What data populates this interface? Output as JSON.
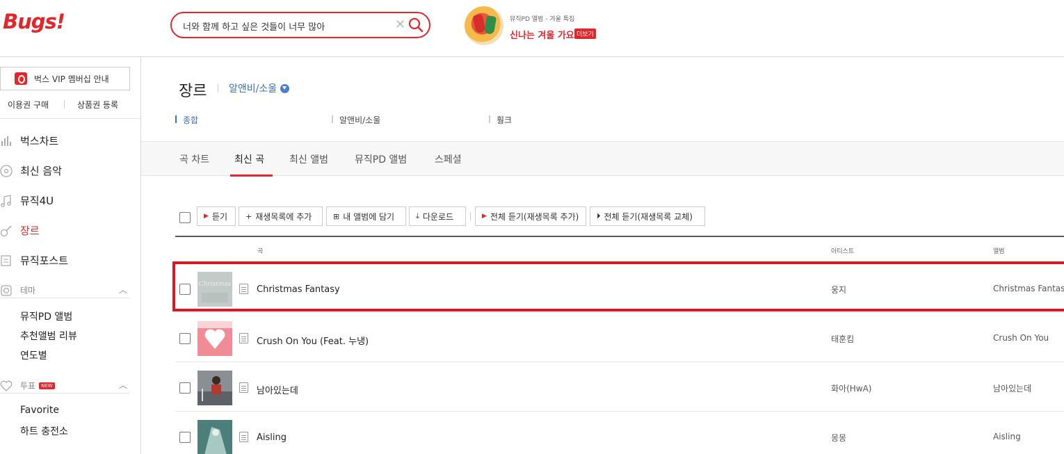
{
  "header": {
    "logo_text": "Bugs!",
    "search_value": "너와 함께 하고 싶은 것들이 너무 많아",
    "promo_subtitle": "뮤직PD 앨범 - 겨울 특집",
    "promo_title": "신나는 겨울 가요",
    "promo_more": "더보기"
  },
  "sidebar": {
    "vip_label": "벅스 VIP 멤버십 안내",
    "buy_pass": "이용권 구매",
    "register_coupon": "상품권 등록",
    "nav": [
      {
        "label": "벅스차트",
        "icon": "chart-icon"
      },
      {
        "label": "최신 음악",
        "icon": "disc-icon"
      },
      {
        "label": "뮤직4U",
        "icon": "music-note-icon"
      },
      {
        "label": "장르",
        "icon": "guitar-icon"
      },
      {
        "label": "뮤직포스트",
        "icon": "post-icon"
      }
    ],
    "theme_label": "테마",
    "theme_items": [
      "뮤직PD 앨범",
      "추천앨범 리뷰",
      "연도별"
    ],
    "vote_label": "투표",
    "vote_badge": "NEW",
    "vote_items": [
      "Favorite",
      "하트 충전소"
    ]
  },
  "main": {
    "genre_title": "장르",
    "genre_selected": "알앤비/소울",
    "subgenres": [
      "종합",
      "알앤비/소울",
      "훵크"
    ],
    "tabs": [
      "곡 차트",
      "최신 곡",
      "최신 앨범",
      "뮤직PD 앨범",
      "스페셜"
    ],
    "toolbar": {
      "listen": "듣기",
      "add_playlist": "재생목록에 추가",
      "add_my_album": "내 앨범에 담기",
      "download": "다운로드",
      "listen_all_add": "전체 듣기(재생목록 추가)",
      "listen_all_replace": "전체 듣기(재생목록 교체)"
    },
    "columns": {
      "song": "곡",
      "artist": "아티스트",
      "album": "앨범"
    },
    "rows": [
      {
        "title": "Christmas Fantasy",
        "artist": "웅지",
        "album": "Christmas Fantasy"
      },
      {
        "title": "Crush On You (Feat. 누냉)",
        "artist": "태훈킴",
        "album": "Crush On You"
      },
      {
        "title": "남아있는데",
        "artist": "화아(HwA)",
        "album": "남아있는데"
      },
      {
        "title": "Aisling",
        "artist": "몽몽",
        "album": "Aisling"
      }
    ]
  },
  "colors": {
    "brand": "#e4262b",
    "link": "#3d6fb6",
    "highlight": "#d01c24"
  }
}
